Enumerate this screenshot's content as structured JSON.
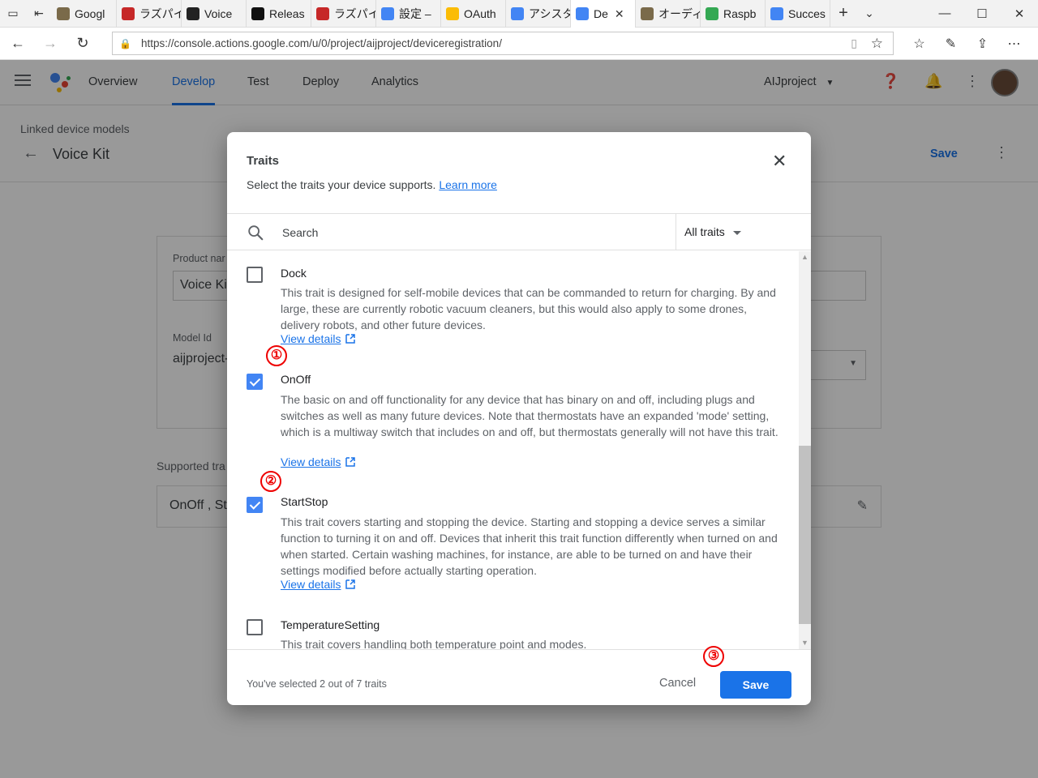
{
  "browser": {
    "tabs": [
      {
        "label": "Googl",
        "color": "#7a6a4a"
      },
      {
        "label": "ラズパイ",
        "color": "#c62828"
      },
      {
        "label": "Voice",
        "color": "#222222"
      },
      {
        "label": "Releas",
        "color": "#111111"
      },
      {
        "label": "ラズパイ",
        "color": "#c62828"
      },
      {
        "label": "設定 –",
        "color": "#4285f4"
      },
      {
        "label": "OAuth",
        "color": "#fbbc05"
      },
      {
        "label": "アシスタ",
        "color": "#4285f4"
      },
      {
        "label": "De",
        "color": "#4285f4",
        "active": true
      },
      {
        "label": "オーディ",
        "color": "#7a6a4a"
      },
      {
        "label": "Raspb",
        "color": "#34a853"
      },
      {
        "label": "Succes",
        "color": "#4285f4"
      }
    ],
    "url": "https://console.actions.google.com/u/0/project/aijproject/deviceregistration/"
  },
  "app": {
    "nav_tabs": [
      "Overview",
      "Develop",
      "Test",
      "Deploy",
      "Analytics"
    ],
    "active_tab": "Develop",
    "project": "AIJproject",
    "breadcrumb": "Linked device models",
    "page_title": "Voice Kit",
    "save_label": "Save",
    "product_name_label": "Product nar",
    "product_name_value": "Voice Ki",
    "model_id_label": "Model Id",
    "model_id_value": "aijproject-",
    "supported_label": "Supported tra",
    "supported_value": "OnOff , Sta"
  },
  "dialog": {
    "title": "Traits",
    "subtitle": "Select the traits your device supports.",
    "learn_more": "Learn more",
    "search_placeholder": "Search",
    "filter_label": "All traits",
    "traits": [
      {
        "name": "Dock",
        "checked": false,
        "desc": "This trait is designed for self-mobile devices that can be commanded to return for charging. By and large, these are currently robotic vacuum cleaners, but this would also apply to some drones, delivery robots, and other future devices.",
        "link": "View details"
      },
      {
        "name": "OnOff",
        "checked": true,
        "desc": "The basic on and off functionality for any device that has binary on and off, including plugs and switches as well as many future devices. Note that thermostats have an expanded 'mode' setting, which is a multiway switch that includes on and off, but thermostats generally will not have this trait.",
        "link": "View details"
      },
      {
        "name": "StartStop",
        "checked": true,
        "desc": "This trait covers starting and stopping the device. Starting and stopping a device serves a similar function to turning it on and off. Devices that inherit this trait function differently when turned on and when started. Certain washing machines, for instance, are able to be turned on and have their settings modified before actually starting operation.",
        "link": "View details"
      },
      {
        "name": "TemperatureSetting",
        "checked": false,
        "desc": "This trait covers handling both temperature point and modes.",
        "link": ""
      }
    ],
    "selection_status": "You've selected 2 out of 7 traits",
    "cancel_label": "Cancel",
    "save_label": "Save"
  },
  "annotations": [
    "①",
    "②",
    "③"
  ]
}
